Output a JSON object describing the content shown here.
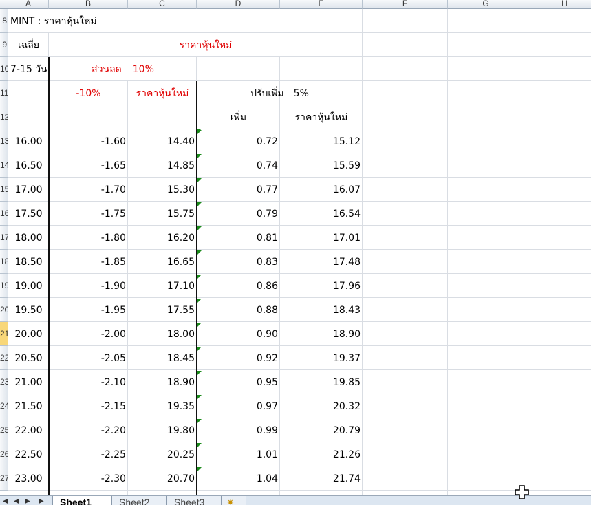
{
  "columns": [
    "A",
    "B",
    "C",
    "D",
    "E",
    "F",
    "G",
    "H"
  ],
  "row_numbers": [
    "8",
    "9",
    "10",
    "11",
    "12",
    "13",
    "14",
    "15",
    "16",
    "17",
    "18",
    "19",
    "20",
    "21",
    "22",
    "23",
    "24",
    "25",
    "26",
    "27"
  ],
  "selected_row": "21",
  "header": {
    "title": "MINT : ราคาหุ้นใหม่",
    "avg_label": "เฉลี่ย",
    "new_price_heading": "ราคาหุ้นใหม่",
    "days_label": "7-15 วัน",
    "discount_label": "ส่วนลด",
    "discount_value": "10%",
    "minus_pct": "-10%",
    "new_price_col": "ราคาหุ้นใหม่",
    "increase_label": "ปรับเพิ่ม",
    "increase_value": "5%",
    "add_label": "เพิ่ม",
    "new_price_col2": "ราคาหุ้นใหม่"
  },
  "rows": [
    [
      "16.00",
      "-1.60",
      "14.40",
      "0.72",
      "15.12"
    ],
    [
      "16.50",
      "-1.65",
      "14.85",
      "0.74",
      "15.59"
    ],
    [
      "17.00",
      "-1.70",
      "15.30",
      "0.77",
      "16.07"
    ],
    [
      "17.50",
      "-1.75",
      "15.75",
      "0.79",
      "16.54"
    ],
    [
      "18.00",
      "-1.80",
      "16.20",
      "0.81",
      "17.01"
    ],
    [
      "18.50",
      "-1.85",
      "16.65",
      "0.83",
      "17.48"
    ],
    [
      "19.00",
      "-1.90",
      "17.10",
      "0.86",
      "17.96"
    ],
    [
      "19.50",
      "-1.95",
      "17.55",
      "0.88",
      "18.43"
    ],
    [
      "20.00",
      "-2.00",
      "18.00",
      "0.90",
      "18.90"
    ],
    [
      "20.50",
      "-2.05",
      "18.45",
      "0.92",
      "19.37"
    ],
    [
      "21.00",
      "-2.10",
      "18.90",
      "0.95",
      "19.85"
    ],
    [
      "21.50",
      "-2.15",
      "19.35",
      "0.97",
      "20.32"
    ],
    [
      "22.00",
      "-2.20",
      "19.80",
      "0.99",
      "20.79"
    ],
    [
      "22.50",
      "-2.25",
      "20.25",
      "1.01",
      "21.26"
    ],
    [
      "23.00",
      "-2.30",
      "20.70",
      "1.04",
      "21.74"
    ]
  ],
  "sheet_tabs": [
    "Sheet1",
    "Sheet2",
    "Sheet3"
  ],
  "active_tab": "Sheet1",
  "colors": {
    "red_text": "#e00000",
    "error_marker": "#1a8a1a",
    "selected_row_header": "#f8d779"
  }
}
